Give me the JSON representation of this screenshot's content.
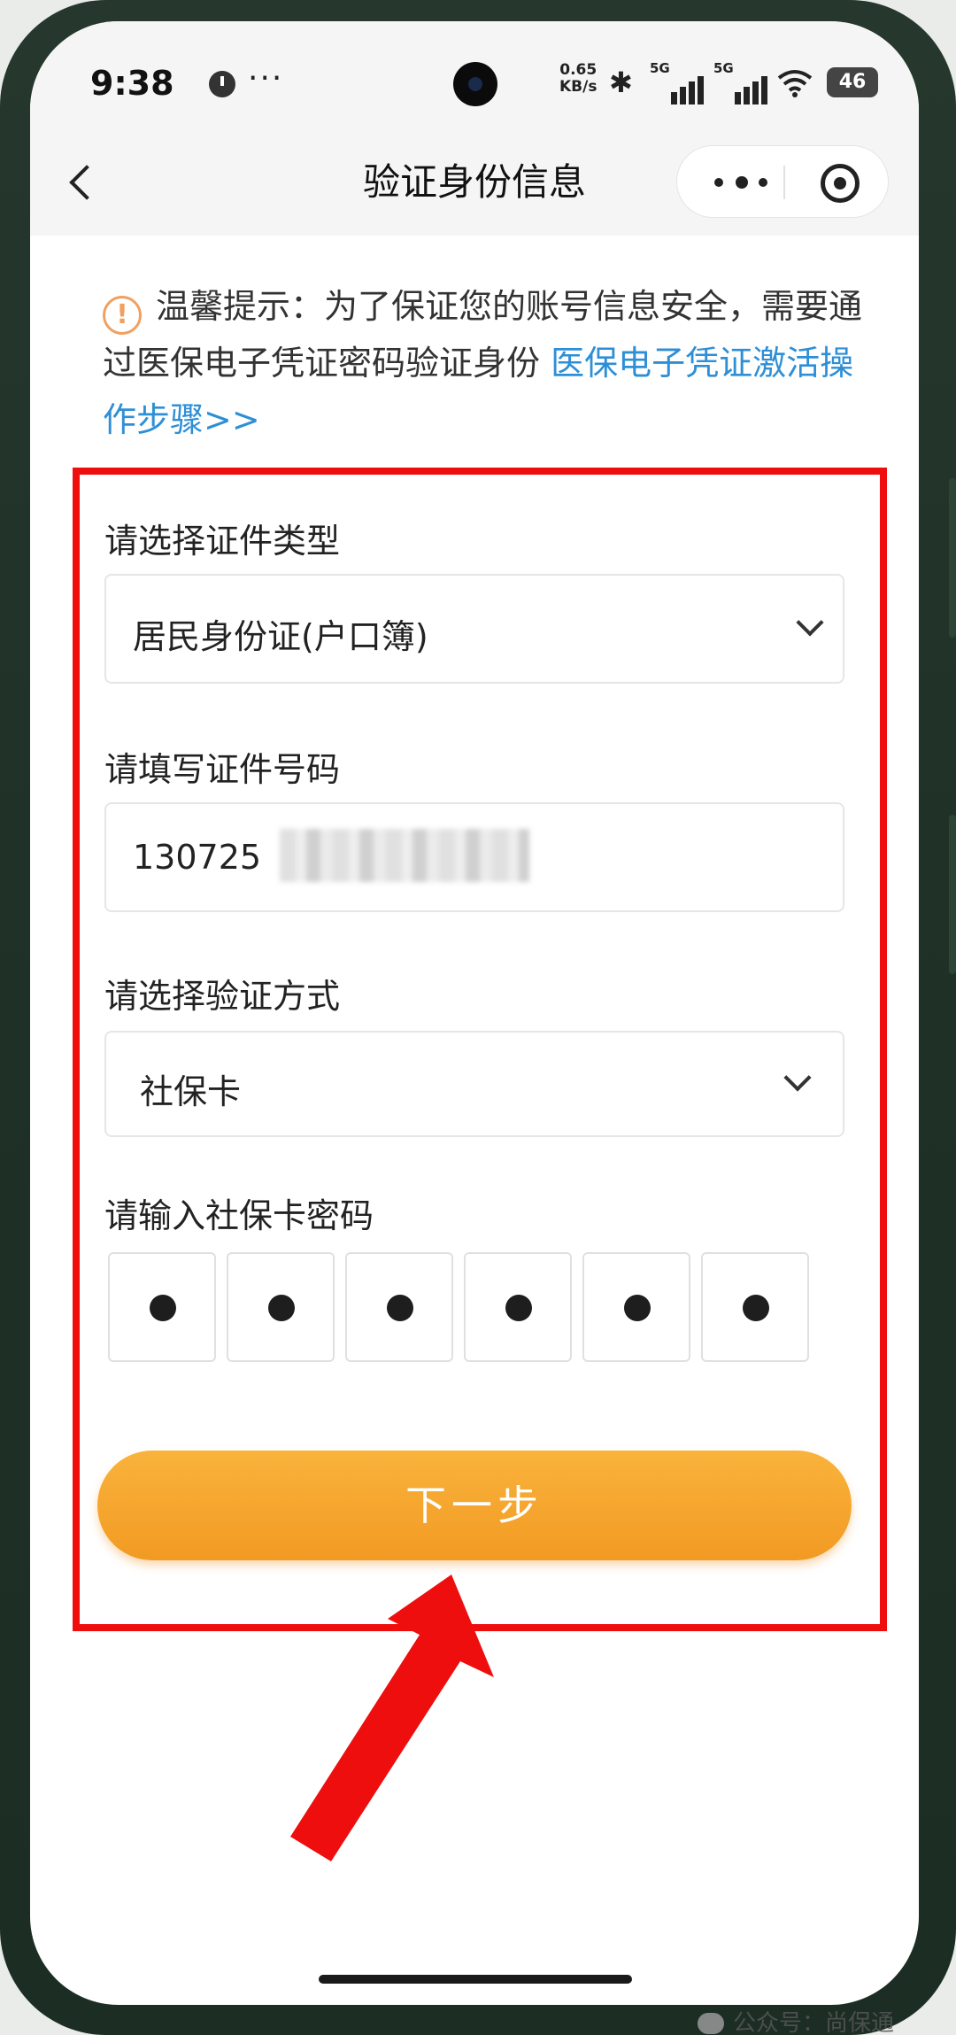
{
  "status_bar": {
    "time": "9:38",
    "dots": "···",
    "net_speed_value": "0.65",
    "net_speed_unit": "KB/s",
    "sim1_label": "5G",
    "sim2_label": "5G",
    "battery": "46"
  },
  "header": {
    "title": "验证身份信息",
    "back_icon": "chevron-left-icon",
    "more_icon": "more-dots-icon",
    "close_icon": "target-close-icon"
  },
  "tip": {
    "icon": "exclamation-icon",
    "text": "温馨提示：为了保证您的账号信息安全，需要通过医保电子凭证密码验证身份 ",
    "link": "医保电子凭证激活操作步骤>>"
  },
  "form": {
    "id_type_label": "请选择证件类型",
    "id_type_value": "居民身份证(户口簿)",
    "id_number_label": "请填写证件号码",
    "id_number_value": "130725",
    "verify_method_label": "请选择验证方式",
    "verify_method_value": "社保卡",
    "password_label": "请输入社保卡密码",
    "password_digits": 6,
    "password_filled": 6,
    "next_button": "下一步"
  },
  "annotation": {
    "box_color": "#ee0e0e",
    "arrow_color": "#ee0e0e"
  },
  "colors": {
    "accent_orange": "#f29a23",
    "link_blue": "#2e8fd6",
    "tip_icon": "#f0a060"
  },
  "watermark": {
    "text": "公众号：尚保通"
  }
}
